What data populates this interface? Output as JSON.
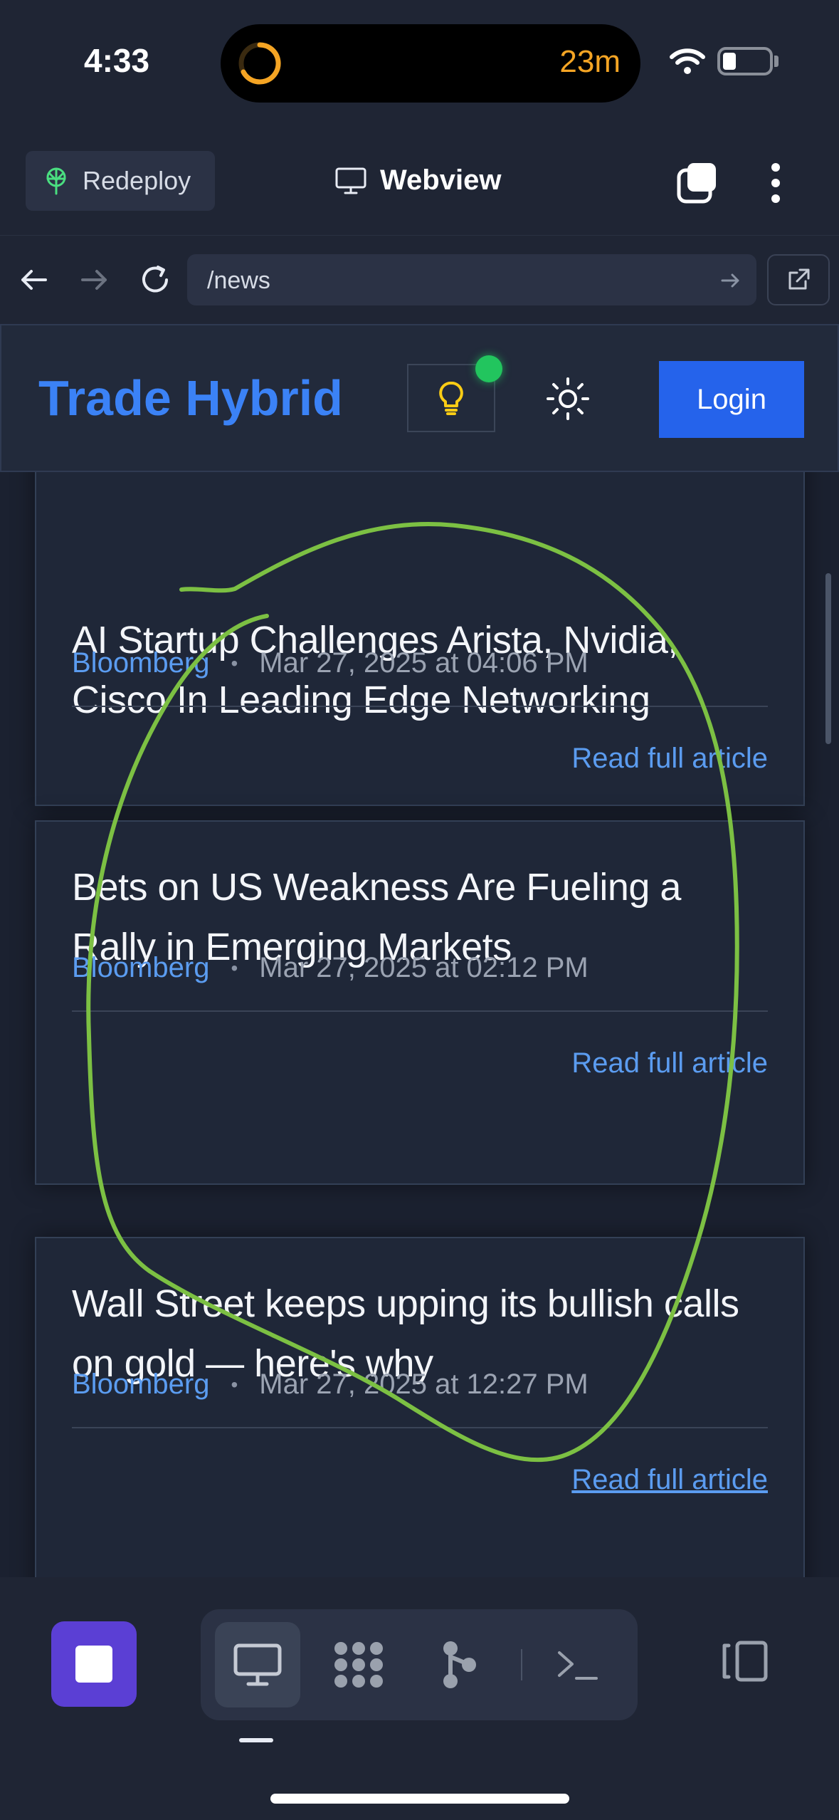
{
  "status_bar": {
    "time": "4:33",
    "timer": "23m"
  },
  "app_bar": {
    "redeploy_label": "Redeploy",
    "title": "Webview"
  },
  "url_bar": {
    "url": "/news"
  },
  "site_header": {
    "logo": "Trade Hybrid",
    "login_label": "Login"
  },
  "articles": [
    {
      "title": "AI Startup Challenges Arista, Nvidia, Cisco In Leading Edge Networking",
      "source": "Bloomberg",
      "separator": "•",
      "date": "Mar 27, 2025 at 04:06 PM",
      "link": "Read full article"
    },
    {
      "title": "Bets on US Weakness Are Fueling a Rally in Emerging Markets",
      "source": "Bloomberg",
      "separator": "•",
      "date": "Mar 27, 2025 at 02:12 PM",
      "link": "Read full article"
    },
    {
      "title": "Wall Street keeps upping its bullish calls on gold — here's why",
      "source": "Bloomberg",
      "separator": "•",
      "date": "Mar 27, 2025 at 12:27 PM",
      "link": "Read full article"
    }
  ],
  "bottom_bar": {
    "tools": [
      "monitor-icon",
      "dots-grid-icon",
      "branch-icon",
      "terminal-icon"
    ],
    "active_tool": "monitor-icon"
  },
  "colors": {
    "accent": "#3b82f6",
    "login": "#2563eb",
    "status_dot": "#22c55e",
    "stop": "#5b3fd4",
    "annotation": "#7cc043"
  }
}
